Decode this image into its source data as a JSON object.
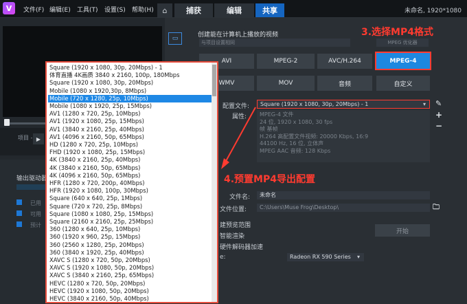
{
  "menubar": {
    "logo": "V",
    "menus": [
      "文件(F)",
      "编辑(E)",
      "工具(T)",
      "设置(S)",
      "帮助(H)"
    ],
    "home_icon": "home-icon",
    "tabs": [
      {
        "label": "捕获",
        "active": false
      },
      {
        "label": "编辑",
        "active": false
      },
      {
        "label": "共享",
        "active": true
      }
    ],
    "project_info": "未命名, 1920*1080"
  },
  "left": {
    "project_label": "项目 -",
    "output_label": "输出驱动器",
    "checks": [
      "已用",
      "可用",
      "预计"
    ]
  },
  "share": {
    "title": "创建能在计算机上播放的视频",
    "top_dropdown": "与项目设置相同",
    "mpeg_opt": "MPEG 优化器",
    "formats": [
      "AVI",
      "MPEG-2",
      "AVC/H.264",
      "MPEG-4",
      "WMV",
      "MOV",
      "音频",
      "自定义"
    ],
    "selected_format": "MPEG-4",
    "annot1": "3.选择MP4格式",
    "annot2": "4.预置MP4导出配置",
    "profile_label": "配置文件:",
    "profile_value": "Square (1920 x 1080, 30p, 20Mbps) - 1",
    "props_label": "属性:",
    "props_lines": [
      "MPEG-4 文件",
      "24 位, 1920 x 1080, 30 fps",
      "帧 基帧",
      "H.264 高配置文件视频: 20000 Kbps, 16:9",
      "44100 Hz, 16 位, 立体声",
      "MPEG AAC 音频: 128 Kbps"
    ],
    "filename_label": "文件名:",
    "filename_value": "未命名",
    "location_label": "文件位置:",
    "location_value": "C:\\Users\\Muse Frog\\Desktop\\",
    "opt1": "建预览范围",
    "opt2": "智能渲染",
    "opt3": "硬件解码器加速",
    "gpu_label": "e:",
    "gpu_value": "Radeon RX 590 Series",
    "start": "开始"
  },
  "dropdown_list": [
    "Square (1920 x 1080, 30p, 20Mbps) - 1",
    "体育直播 4K画质 3840 x 2160, 100p, 180Mbps",
    "Square (1920 x 1080, 30p, 20Mbps)",
    "Mobile (1080 x 1920,30p, 8Mbps)",
    "Mobile (720 x 1280, 25p, 10Mbps)",
    "Mobile (1080 x 1920, 25p, 15Mbps)",
    "AV1 (1280 x 720, 25p, 10Mbps)",
    "AV1 (1920 x 1080, 25p, 15Mbps)",
    "AV1 (3840 x 2160, 25p, 40Mbps)",
    "AV1 (4096 x 2160, 50p, 65Mbps)",
    "HD (1280 x 720, 25p, 10Mbps)",
    "FHD (1920 x 1080, 25p, 15Mbps)",
    "4K (3840 x 2160, 25p, 40Mbps)",
    "4K (3840 x 2160, 50p, 65Mbps)",
    "4K (4096 x 2160, 50p, 65Mbps)",
    "HFR (1280 x 720, 200p, 40Mbps)",
    "HFR (1920 x 1080, 100p, 30Mbps)",
    "Square (640 x 640, 25p, 1Mbps)",
    "Square (720 x 720, 25p, 8Mbps)",
    "Square (1080 x 1080, 25p, 15Mbps)",
    "Square (2160 x 2160, 25p, 25Mbps)",
    "360 (1280 x 640, 25p, 10Mbps)",
    "360 (1920 x 960, 25p, 15Mbps)",
    "360 (2560 x 1280, 25p, 20Mbps)",
    "360 (3840 x 1920, 25p, 40Mbps)",
    "XAVC S (1280 x 720, 50p, 20Mbps)",
    "XAVC S (1920 x 1080, 50p, 20Mbps)",
    "XAVC S (3840 x 2160, 25p, 65Mbps)",
    "HEVC (1280 x 720, 50p, 20Mbps)",
    "HEVC (1920 x 1080, 50p, 20Mbps)",
    "HEVC (3840 x 2160, 50p, 40Mbps)"
  ],
  "dropdown_highlight": 4,
  "colors": {
    "accent": "#1d88e0",
    "annotation": "#ff3b30"
  }
}
